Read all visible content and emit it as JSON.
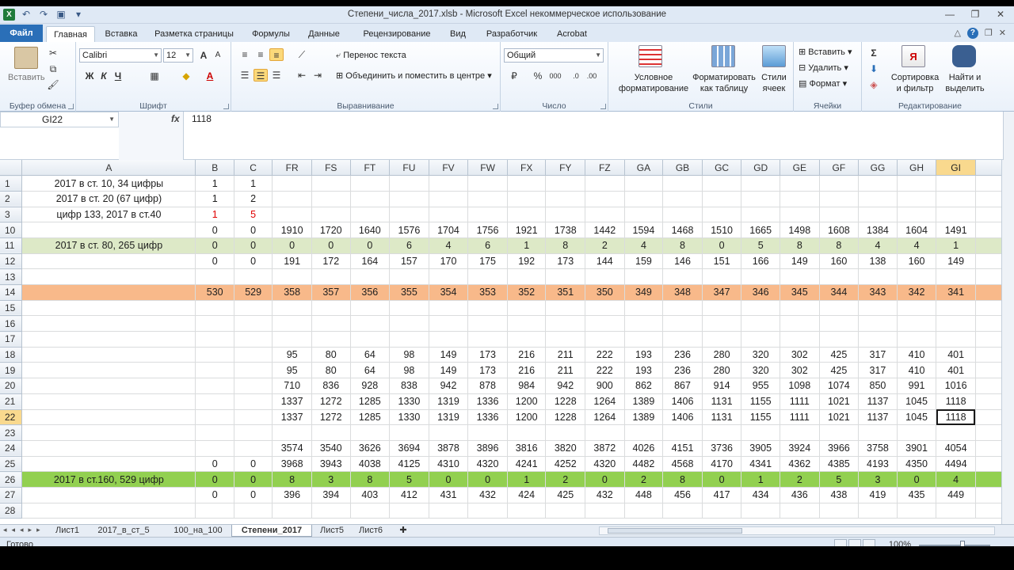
{
  "window": {
    "title": "Степени_числа_2017.xlsb - Microsoft Excel некоммерческое использование"
  },
  "ribbon_tabs": [
    "Файл",
    "Главная",
    "Вставка",
    "Разметка страницы",
    "Формулы",
    "Данные",
    "Рецензирование",
    "Вид",
    "Разработчик",
    "Acrobat"
  ],
  "ribbon": {
    "paste": "Вставить",
    "clipboard": "Буфер обмена",
    "font_name": "Calibri",
    "font_size": "12",
    "font_group": "Шрифт",
    "wrap": "Перенос текста",
    "merge": "Объединить и поместить в центре",
    "align_group": "Выравнивание",
    "number_format": "Общий",
    "number_group": "Число",
    "cond_format": "Условное",
    "cond_format2": "форматирование",
    "as_table": "Форматировать",
    "as_table2": "как таблицу",
    "cell_styles": "Стили",
    "cell_styles2": "ячеек",
    "styles_group": "Стили",
    "insert": "Вставить",
    "delete": "Удалить",
    "format": "Формат",
    "cells_group": "Ячейки",
    "sort": "Сортировка",
    "sort2": "и фильтр",
    "find": "Найти и",
    "find2": "выделить",
    "edit_group": "Редактирование"
  },
  "formula_bar": {
    "name_box": "GI22",
    "fx": "fx",
    "content": "1118"
  },
  "columns": [
    "A",
    "B",
    "C",
    "FR",
    "FS",
    "FT",
    "FU",
    "FV",
    "FW",
    "FX",
    "FY",
    "FZ",
    "GA",
    "GB",
    "GC",
    "GD",
    "GE",
    "GF",
    "GG",
    "GH",
    "GI"
  ],
  "selected_column": "GI",
  "selected_row": "22",
  "rows": [
    {
      "n": "1",
      "a": "2017 в ст. 10, 34 цифры",
      "b": "1",
      "c": "1",
      "v": [
        "",
        "",
        "",
        "",
        "",
        "",
        "",
        "",
        "",
        "",
        "",
        "",
        "",
        "",
        "",
        "",
        "",
        ""
      ]
    },
    {
      "n": "2",
      "a": "2017 в ст. 20 (67 цифр)",
      "b": "1",
      "c": "2",
      "v": [
        "",
        "",
        "",
        "",
        "",
        "",
        "",
        "",
        "",
        "",
        "",
        "",
        "",
        "",
        "",
        "",
        "",
        ""
      ]
    },
    {
      "n": "3",
      "a": "цифр 133, 2017 в ст.40",
      "b": "1",
      "c": "5",
      "v": [
        "",
        "",
        "",
        "",
        "",
        "",
        "",
        "",
        "",
        "",
        "",
        "",
        "",
        "",
        "",
        "",
        "",
        ""
      ]
    },
    {
      "n": "10",
      "a": "",
      "b": "0",
      "c": "0",
      "v": [
        "1910",
        "1720",
        "1640",
        "1576",
        "1704",
        "1756",
        "1921",
        "1738",
        "1442",
        "1594",
        "1468",
        "1510",
        "1665",
        "1498",
        "1608",
        "1384",
        "1604",
        "1491"
      ]
    },
    {
      "n": "11",
      "a": "2017 в ст. 80, 265 цифр",
      "b": "0",
      "c": "0",
      "v": [
        "0",
        "0",
        "0",
        "6",
        "4",
        "6",
        "1",
        "8",
        "2",
        "4",
        "8",
        "0",
        "5",
        "8",
        "8",
        "4",
        "4",
        "1"
      ]
    },
    {
      "n": "12",
      "a": "",
      "b": "0",
      "c": "0",
      "v": [
        "191",
        "172",
        "164",
        "157",
        "170",
        "175",
        "192",
        "173",
        "144",
        "159",
        "146",
        "151",
        "166",
        "149",
        "160",
        "138",
        "160",
        "149"
      ]
    },
    {
      "n": "13",
      "a": "",
      "b": "",
      "c": "",
      "v": [
        "",
        "",
        "",
        "",
        "",
        "",
        "",
        "",
        "",
        "",
        "",
        "",
        "",
        "",
        "",
        "",
        "",
        ""
      ]
    },
    {
      "n": "14",
      "a": "",
      "b": "530",
      "c": "529",
      "v": [
        "358",
        "357",
        "356",
        "355",
        "354",
        "353",
        "352",
        "351",
        "350",
        "349",
        "348",
        "347",
        "346",
        "345",
        "344",
        "343",
        "342",
        "341"
      ]
    },
    {
      "n": "15",
      "a": "",
      "b": "",
      "c": "",
      "v": [
        "",
        "",
        "",
        "",
        "",
        "",
        "",
        "",
        "",
        "",
        "",
        "",
        "",
        "",
        "",
        "",
        "",
        ""
      ]
    },
    {
      "n": "16",
      "a": "",
      "b": "",
      "c": "",
      "v": [
        "",
        "",
        "",
        "",
        "",
        "",
        "",
        "",
        "",
        "",
        "",
        "",
        "",
        "",
        "",
        "",
        "",
        ""
      ]
    },
    {
      "n": "17",
      "a": "",
      "b": "",
      "c": "",
      "v": [
        "",
        "",
        "",
        "",
        "",
        "",
        "",
        "",
        "",
        "",
        "",
        "",
        "",
        "",
        "",
        "",
        "",
        ""
      ]
    },
    {
      "n": "18",
      "a": "",
      "b": "",
      "c": "",
      "v": [
        "95",
        "80",
        "64",
        "98",
        "149",
        "173",
        "216",
        "211",
        "222",
        "193",
        "236",
        "280",
        "320",
        "302",
        "425",
        "317",
        "410",
        "401"
      ]
    },
    {
      "n": "19",
      "a": "",
      "b": "",
      "c": "",
      "v": [
        "95",
        "80",
        "64",
        "98",
        "149",
        "173",
        "216",
        "211",
        "222",
        "193",
        "236",
        "280",
        "320",
        "302",
        "425",
        "317",
        "410",
        "401"
      ]
    },
    {
      "n": "20",
      "a": "",
      "b": "",
      "c": "",
      "v": [
        "710",
        "836",
        "928",
        "838",
        "942",
        "878",
        "984",
        "942",
        "900",
        "862",
        "867",
        "914",
        "955",
        "1098",
        "1074",
        "850",
        "991",
        "1016"
      ]
    },
    {
      "n": "21",
      "a": "",
      "b": "",
      "c": "",
      "v": [
        "1337",
        "1272",
        "1285",
        "1330",
        "1319",
        "1336",
        "1200",
        "1228",
        "1264",
        "1389",
        "1406",
        "1131",
        "1155",
        "1111",
        "1021",
        "1137",
        "1045",
        "1118"
      ]
    },
    {
      "n": "22",
      "a": "",
      "b": "",
      "c": "",
      "v": [
        "1337",
        "1272",
        "1285",
        "1330",
        "1319",
        "1336",
        "1200",
        "1228",
        "1264",
        "1389",
        "1406",
        "1131",
        "1155",
        "1111",
        "1021",
        "1137",
        "1045",
        "1118"
      ]
    },
    {
      "n": "23",
      "a": "",
      "b": "",
      "c": "",
      "v": [
        "",
        "",
        "",
        "",
        "",
        "",
        "",
        "",
        "",
        "",
        "",
        "",
        "",
        "",
        "",
        "",
        "",
        ""
      ]
    },
    {
      "n": "24",
      "a": "",
      "b": "",
      "c": "",
      "v": [
        "3574",
        "3540",
        "3626",
        "3694",
        "3878",
        "3896",
        "3816",
        "3820",
        "3872",
        "4026",
        "4151",
        "3736",
        "3905",
        "3924",
        "3966",
        "3758",
        "3901",
        "4054"
      ]
    },
    {
      "n": "25",
      "a": "",
      "b": "0",
      "c": "0",
      "v": [
        "3968",
        "3943",
        "4038",
        "4125",
        "4310",
        "4320",
        "4241",
        "4252",
        "4320",
        "4482",
        "4568",
        "4170",
        "4341",
        "4362",
        "4385",
        "4193",
        "4350",
        "4494"
      ]
    },
    {
      "n": "26",
      "a": "2017 в ст.160, 529 цифр",
      "b": "0",
      "c": "0",
      "v": [
        "8",
        "3",
        "8",
        "5",
        "0",
        "0",
        "1",
        "2",
        "0",
        "2",
        "8",
        "0",
        "1",
        "2",
        "5",
        "3",
        "0",
        "4"
      ]
    },
    {
      "n": "27",
      "a": "",
      "b": "0",
      "c": "0",
      "v": [
        "396",
        "394",
        "403",
        "412",
        "431",
        "432",
        "424",
        "425",
        "432",
        "448",
        "456",
        "417",
        "434",
        "436",
        "438",
        "419",
        "435",
        "449"
      ]
    },
    {
      "n": "28",
      "a": "",
      "b": "",
      "c": "",
      "v": [
        "",
        "",
        "",
        "",
        "",
        "",
        "",
        "",
        "",
        "",
        "",
        "",
        "",
        "",
        "",
        "",
        "",
        ""
      ]
    }
  ],
  "row_styles": {
    "11": "r11",
    "14": "r14",
    "26": "r26"
  },
  "red_cells_row": "3",
  "sheet_tabs": [
    "Лист1",
    "2017_в_ст_5",
    "100_на_100",
    "Степени_2017",
    "Лист5",
    "Лист6"
  ],
  "active_sheet": "Степени_2017",
  "status": {
    "ready": "Готово",
    "zoom": "100%"
  }
}
